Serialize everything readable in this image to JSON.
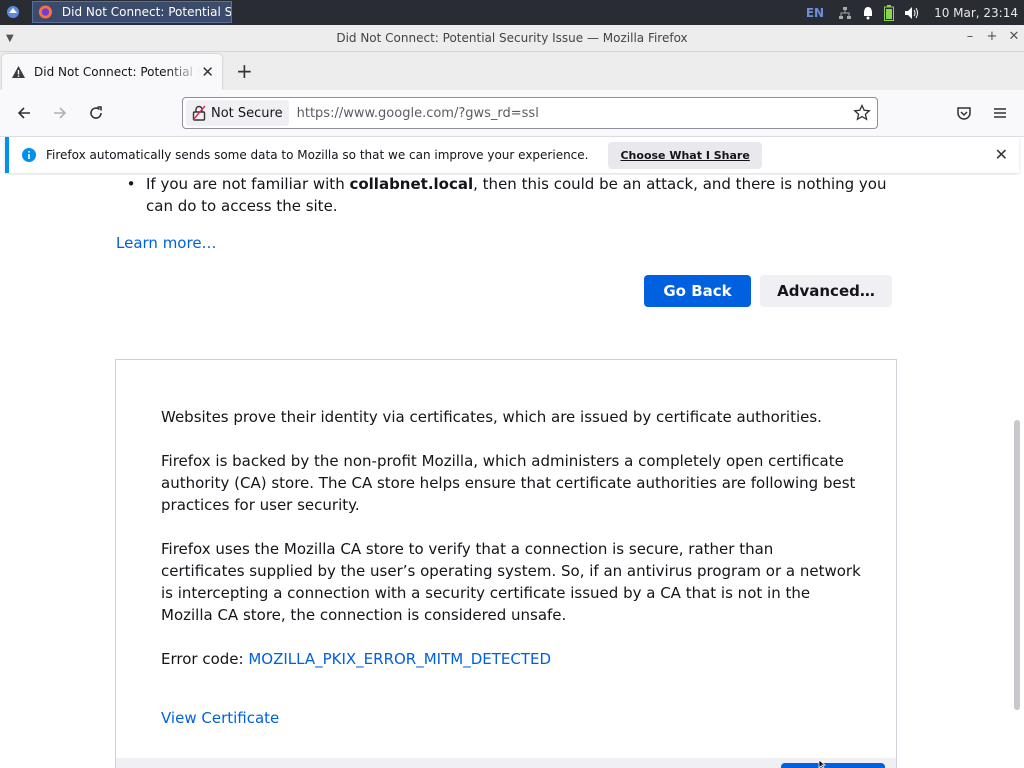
{
  "taskbar": {
    "task_title": "Did Not Connect: Potential S...",
    "language": "EN",
    "clock": "10 Mar, 23:14",
    "icons": [
      "start-menu-icon",
      "firefox-icon",
      "network-icon",
      "bell-icon",
      "battery-icon",
      "volume-icon"
    ]
  },
  "window": {
    "title": "Did Not Connect: Potential Security Issue — Mozilla Firefox"
  },
  "tab": {
    "title": "Did Not Connect: Potential Security Issue"
  },
  "navbar": {
    "security_label": "Not Secure",
    "url": "https://www.google.com/?gws_rd=ssl"
  },
  "notification": {
    "message": "Firefox automatically sends some data to Mozilla so that we can improve your experience.",
    "action_label": "Choose What I Share"
  },
  "page": {
    "bullet_prefix": "If you are not familiar with ",
    "bullet_host": "collabnet.local",
    "bullet_suffix": ", then this could be an attack, and there is nothing you can do to access the site.",
    "learn_more": "Learn more…",
    "go_back": "Go Back",
    "advanced": "Advanced…",
    "panel": {
      "p1": "Websites prove their identity via certificates, which are issued by certificate authorities.",
      "p2": "Firefox is backed by the non-profit Mozilla, which administers a completely open certificate authority (CA) store. The CA store helps ensure that certificate authorities are following best practices for user security.",
      "p3": "Firefox uses the Mozilla CA store to verify that a connection is secure, rather than certificates supplied by the user’s operating system. So, if an antivirus program or a network is intercepting a connection with a security certificate issued by a CA that is not in the Mozilla CA store, the connection is considered unsafe.",
      "error_label": "Error code: ",
      "error_code": "MOZILLA_PKIX_ERROR_MITM_DETECTED",
      "view_certificate": "View Certificate"
    }
  },
  "colors": {
    "accent": "#0061e0",
    "info": "#0090ed",
    "taskbar": "#2a2c34"
  }
}
